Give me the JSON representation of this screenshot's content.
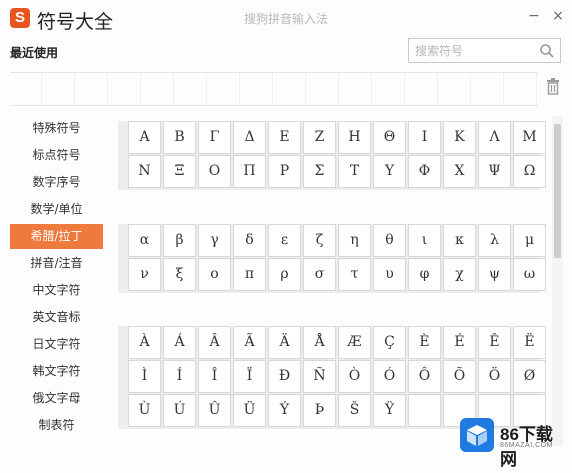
{
  "title_bar": {
    "logo_letter": "S",
    "app_title": "符号大全",
    "sub_title": "搜狗拼音输入法",
    "minimize": "−",
    "close": "×"
  },
  "recent": {
    "label": "最近使用",
    "search_placeholder": "搜索符号"
  },
  "sidebar": {
    "items": [
      {
        "label": "特殊符号",
        "active": false
      },
      {
        "label": "标点符号",
        "active": false
      },
      {
        "label": "数字序号",
        "active": false
      },
      {
        "label": "数学/单位",
        "active": false
      },
      {
        "label": "希腊/拉丁",
        "active": true
      },
      {
        "label": "拼音/注音",
        "active": false
      },
      {
        "label": "中文字符",
        "active": false
      },
      {
        "label": "英文音标",
        "active": false
      },
      {
        "label": "日文字符",
        "active": false
      },
      {
        "label": "韩文字符",
        "active": false
      },
      {
        "label": "俄文字母",
        "active": false
      },
      {
        "label": "制表符",
        "active": false
      }
    ]
  },
  "symbol_groups": [
    {
      "rows": [
        [
          "Α",
          "Β",
          "Γ",
          "Δ",
          "Ε",
          "Ζ",
          "Η",
          "Θ",
          "Ι",
          "Κ",
          "Λ",
          "Μ"
        ],
        [
          "Ν",
          "Ξ",
          "Ο",
          "Π",
          "Ρ",
          "Σ",
          "Τ",
          "Υ",
          "Φ",
          "Χ",
          "Ψ",
          "Ω"
        ]
      ]
    },
    {
      "rows": [
        [
          "α",
          "β",
          "γ",
          "δ",
          "ε",
          "ζ",
          "η",
          "θ",
          "ι",
          "κ",
          "λ",
          "μ"
        ],
        [
          "ν",
          "ξ",
          "ο",
          "π",
          "ρ",
          "σ",
          "τ",
          "υ",
          "φ",
          "χ",
          "ψ",
          "ω"
        ]
      ]
    },
    {
      "rows": [
        [
          "À",
          "Á",
          "Â",
          "Ã",
          "Ä",
          "Å",
          "Æ",
          "Ç",
          "È",
          "É",
          "Ê",
          "Ë"
        ],
        [
          "Ì",
          "Í",
          "Î",
          "Ï",
          "Ð",
          "Ñ",
          "Ò",
          "Ó",
          "Ô",
          "Õ",
          "Ö",
          "Ø"
        ],
        [
          "Ù",
          "Ú",
          "Û",
          "Ü",
          "Ý",
          "Þ",
          "Š",
          "Ÿ",
          "",
          "",
          "",
          ""
        ]
      ]
    }
  ],
  "watermark": {
    "text": "86下载网",
    "sub": "86MAZAI.COM"
  },
  "colors": {
    "accent": "#ef7a3e",
    "logo": "#e8541e",
    "watermark_blue": "#1f7be0"
  }
}
